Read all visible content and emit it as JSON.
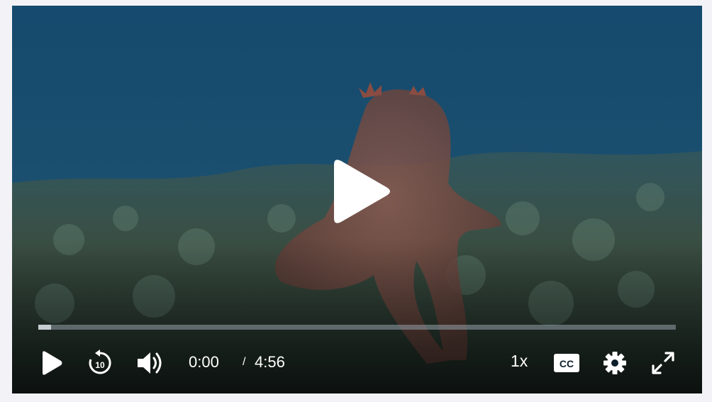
{
  "player": {
    "current_time": "0:00",
    "separator": "/",
    "duration": "4:56",
    "progress_fraction": 0.02,
    "speed_label": "1x",
    "cc_label": "CC",
    "rewind_seconds": "10"
  },
  "icons": {
    "big_play": "play-icon",
    "play": "play-icon",
    "rewind": "rewind-10-icon",
    "volume": "volume-icon",
    "captions": "closed-captions-icon",
    "settings": "gear-icon",
    "fullscreen": "fullscreen-icon"
  },
  "colors": {
    "water_top": "#1a4f74",
    "water_bottom": "#0d2a3c",
    "controls": "#ffffff"
  }
}
